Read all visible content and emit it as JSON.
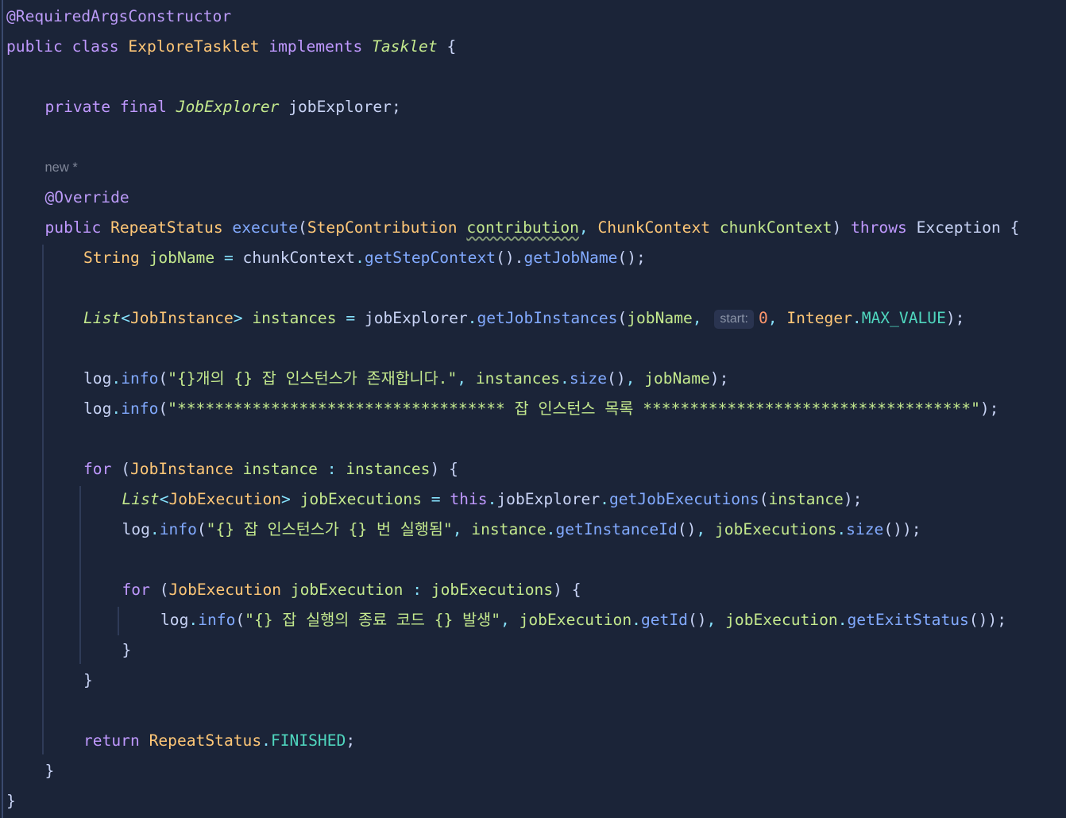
{
  "editor": {
    "lines": [
      {
        "indent": 0,
        "tokens": [
          {
            "t": "@RequiredArgsConstructor",
            "c": "#bb9af7"
          }
        ]
      },
      {
        "indent": 0,
        "tokens": [
          {
            "t": "public class ",
            "c": "#c099ff"
          },
          {
            "t": "ExploreTasklet",
            "c": "#ffc777"
          },
          {
            "t": " implements ",
            "c": "#c099ff"
          },
          {
            "t": "Tasklet",
            "c": "#c3e88d",
            "s": "italic"
          },
          {
            "t": " {",
            "c": "#c8d3f5"
          }
        ]
      },
      {
        "indent": 0,
        "tokens": []
      },
      {
        "indent": 1,
        "tokens": [
          {
            "t": "private final ",
            "c": "#c099ff"
          },
          {
            "t": "JobExplorer",
            "c": "#c3e88d",
            "s": "italic"
          },
          {
            "t": " jobExplorer;",
            "c": "#c8d3f5"
          }
        ]
      },
      {
        "indent": 0,
        "tokens": []
      },
      {
        "indent": 1,
        "meta": true,
        "tokens": [
          {
            "t": "new *",
            "c": "#7f8698"
          }
        ]
      },
      {
        "indent": 1,
        "tokens": [
          {
            "t": "@Override",
            "c": "#bb9af7"
          }
        ]
      },
      {
        "indent": 1,
        "tokens": [
          {
            "t": "public ",
            "c": "#c099ff"
          },
          {
            "t": "RepeatStatus",
            "c": "#ffc777"
          },
          {
            "t": " execute",
            "c": "#82aaff"
          },
          {
            "t": "(",
            "c": "#c8d3f5"
          },
          {
            "t": "StepContribution",
            "c": "#ffc777"
          },
          {
            "t": " ",
            "c": "#c8d3f5"
          },
          {
            "t": "contribution",
            "c": "#c3e88d",
            "u": true
          },
          {
            "t": ", ",
            "c": "#86e1fc"
          },
          {
            "t": "ChunkContext",
            "c": "#ffc777"
          },
          {
            "t": " chunkContext",
            "c": "#c3e88d"
          },
          {
            "t": ") ",
            "c": "#c8d3f5"
          },
          {
            "t": "throws ",
            "c": "#c099ff"
          },
          {
            "t": "Exception",
            "c": "#c8d3f5"
          },
          {
            "t": " {",
            "c": "#c8d3f5"
          }
        ]
      },
      {
        "indent": 2,
        "tokens": [
          {
            "t": "String",
            "c": "#ffc777"
          },
          {
            "t": " jobName ",
            "c": "#c3e88d"
          },
          {
            "t": "= ",
            "c": "#86e1fc"
          },
          {
            "t": "chunkContext",
            "c": "#c8d3f5"
          },
          {
            "t": ".",
            "c": "#86e1fc"
          },
          {
            "t": "getStepContext",
            "c": "#82aaff"
          },
          {
            "t": "().",
            "c": "#c8d3f5"
          },
          {
            "t": "getJobName",
            "c": "#82aaff"
          },
          {
            "t": "();",
            "c": "#c8d3f5"
          }
        ]
      },
      {
        "indent": 0,
        "tokens": []
      },
      {
        "indent": 2,
        "tokens": [
          {
            "t": "List",
            "c": "#c3e88d",
            "s": "italic"
          },
          {
            "t": "<",
            "c": "#86e1fc"
          },
          {
            "t": "JobInstance",
            "c": "#ffc777"
          },
          {
            "t": "> ",
            "c": "#86e1fc"
          },
          {
            "t": "instances ",
            "c": "#c3e88d"
          },
          {
            "t": "= ",
            "c": "#86e1fc"
          },
          {
            "t": "jobExplorer",
            "c": "#c8d3f5"
          },
          {
            "t": ".",
            "c": "#86e1fc"
          },
          {
            "t": "getJobInstances",
            "c": "#82aaff"
          },
          {
            "t": "(",
            "c": "#c8d3f5"
          },
          {
            "t": "jobName",
            "c": "#c3e88d"
          },
          {
            "t": ", ",
            "c": "#86e1fc"
          },
          {
            "hint": "start:"
          },
          {
            "t": "0",
            "c": "#ff966c"
          },
          {
            "t": ", ",
            "c": "#86e1fc"
          },
          {
            "t": "Integer",
            "c": "#ffc777"
          },
          {
            "t": ".",
            "c": "#86e1fc"
          },
          {
            "t": "MAX_VALUE",
            "c": "#4fd6be"
          },
          {
            "t": ");",
            "c": "#c8d3f5"
          }
        ]
      },
      {
        "indent": 0,
        "tokens": []
      },
      {
        "indent": 2,
        "tokens": [
          {
            "t": "log",
            "c": "#c8d3f5"
          },
          {
            "t": ".",
            "c": "#86e1fc"
          },
          {
            "t": "info",
            "c": "#82aaff"
          },
          {
            "t": "(",
            "c": "#c8d3f5"
          },
          {
            "t": "\"{}개의 {} 잡 인스턴스가 존재합니다.\"",
            "c": "#c3e88d"
          },
          {
            "t": ", ",
            "c": "#86e1fc"
          },
          {
            "t": "instances",
            "c": "#c3e88d"
          },
          {
            "t": ".",
            "c": "#86e1fc"
          },
          {
            "t": "size",
            "c": "#82aaff"
          },
          {
            "t": "()",
            "c": "#c8d3f5"
          },
          {
            "t": ", ",
            "c": "#86e1fc"
          },
          {
            "t": "jobName",
            "c": "#c3e88d"
          },
          {
            "t": ");",
            "c": "#c8d3f5"
          }
        ]
      },
      {
        "indent": 2,
        "tokens": [
          {
            "t": "log",
            "c": "#c8d3f5"
          },
          {
            "t": ".",
            "c": "#86e1fc"
          },
          {
            "t": "info",
            "c": "#82aaff"
          },
          {
            "t": "(",
            "c": "#c8d3f5"
          },
          {
            "t": "\"*********************************** 잡 인스턴스 목록 ***********************************\"",
            "c": "#c3e88d"
          },
          {
            "t": ");",
            "c": "#c8d3f5"
          }
        ]
      },
      {
        "indent": 0,
        "tokens": []
      },
      {
        "indent": 2,
        "tokens": [
          {
            "t": "for ",
            "c": "#c099ff"
          },
          {
            "t": "(",
            "c": "#c8d3f5"
          },
          {
            "t": "JobInstance",
            "c": "#ffc777"
          },
          {
            "t": " instance ",
            "c": "#c3e88d"
          },
          {
            "t": ": ",
            "c": "#86e1fc"
          },
          {
            "t": "instances",
            "c": "#c3e88d"
          },
          {
            "t": ") {",
            "c": "#c8d3f5"
          }
        ]
      },
      {
        "indent": 3,
        "tokens": [
          {
            "t": "List",
            "c": "#c3e88d",
            "s": "italic"
          },
          {
            "t": "<",
            "c": "#86e1fc"
          },
          {
            "t": "JobExecution",
            "c": "#ffc777"
          },
          {
            "t": "> ",
            "c": "#86e1fc"
          },
          {
            "t": "jobExecutions ",
            "c": "#c3e88d"
          },
          {
            "t": "= ",
            "c": "#86e1fc"
          },
          {
            "t": "this",
            "c": "#c099ff"
          },
          {
            "t": ".",
            "c": "#86e1fc"
          },
          {
            "t": "jobExplorer",
            "c": "#c8d3f5"
          },
          {
            "t": ".",
            "c": "#86e1fc"
          },
          {
            "t": "getJobExecutions",
            "c": "#82aaff"
          },
          {
            "t": "(",
            "c": "#c8d3f5"
          },
          {
            "t": "instance",
            "c": "#c3e88d"
          },
          {
            "t": ");",
            "c": "#c8d3f5"
          }
        ]
      },
      {
        "indent": 3,
        "tokens": [
          {
            "t": "log",
            "c": "#c8d3f5"
          },
          {
            "t": ".",
            "c": "#86e1fc"
          },
          {
            "t": "info",
            "c": "#82aaff"
          },
          {
            "t": "(",
            "c": "#c8d3f5"
          },
          {
            "t": "\"{} 잡 인스턴스가 {} 번 실행됨\"",
            "c": "#c3e88d"
          },
          {
            "t": ", ",
            "c": "#86e1fc"
          },
          {
            "t": "instance",
            "c": "#c3e88d"
          },
          {
            "t": ".",
            "c": "#86e1fc"
          },
          {
            "t": "getInstanceId",
            "c": "#82aaff"
          },
          {
            "t": "()",
            "c": "#c8d3f5"
          },
          {
            "t": ", ",
            "c": "#86e1fc"
          },
          {
            "t": "jobExecutions",
            "c": "#c3e88d"
          },
          {
            "t": ".",
            "c": "#86e1fc"
          },
          {
            "t": "size",
            "c": "#82aaff"
          },
          {
            "t": "());",
            "c": "#c8d3f5"
          }
        ]
      },
      {
        "indent": 0,
        "tokens": []
      },
      {
        "indent": 3,
        "tokens": [
          {
            "t": "for ",
            "c": "#c099ff"
          },
          {
            "t": "(",
            "c": "#c8d3f5"
          },
          {
            "t": "JobExecution",
            "c": "#ffc777"
          },
          {
            "t": " jobExecution ",
            "c": "#c3e88d"
          },
          {
            "t": ": ",
            "c": "#86e1fc"
          },
          {
            "t": "jobExecutions",
            "c": "#c3e88d"
          },
          {
            "t": ") {",
            "c": "#c8d3f5"
          }
        ]
      },
      {
        "indent": 4,
        "tokens": [
          {
            "t": "log",
            "c": "#c8d3f5"
          },
          {
            "t": ".",
            "c": "#86e1fc"
          },
          {
            "t": "info",
            "c": "#82aaff"
          },
          {
            "t": "(",
            "c": "#c8d3f5"
          },
          {
            "t": "\"{} 잡 실행의 종료 코드 {} 발생\"",
            "c": "#c3e88d"
          },
          {
            "t": ", ",
            "c": "#86e1fc"
          },
          {
            "t": "jobExecution",
            "c": "#c3e88d"
          },
          {
            "t": ".",
            "c": "#86e1fc"
          },
          {
            "t": "getId",
            "c": "#82aaff"
          },
          {
            "t": "()",
            "c": "#c8d3f5"
          },
          {
            "t": ", ",
            "c": "#86e1fc"
          },
          {
            "t": "jobExecution",
            "c": "#c3e88d"
          },
          {
            "t": ".",
            "c": "#86e1fc"
          },
          {
            "t": "getExitStatus",
            "c": "#82aaff"
          },
          {
            "t": "());",
            "c": "#c8d3f5"
          }
        ]
      },
      {
        "indent": 3,
        "tokens": [
          {
            "t": "}",
            "c": "#c8d3f5"
          }
        ]
      },
      {
        "indent": 2,
        "tokens": [
          {
            "t": "}",
            "c": "#c8d3f5"
          }
        ]
      },
      {
        "indent": 0,
        "tokens": []
      },
      {
        "indent": 2,
        "tokens": [
          {
            "t": "return ",
            "c": "#c099ff"
          },
          {
            "t": "RepeatStatus",
            "c": "#ffc777"
          },
          {
            "t": ".",
            "c": "#86e1fc"
          },
          {
            "t": "FINISHED",
            "c": "#4fd6be"
          },
          {
            "t": ";",
            "c": "#c8d3f5"
          }
        ]
      },
      {
        "indent": 1,
        "tokens": [
          {
            "t": "}",
            "c": "#c8d3f5"
          }
        ]
      },
      {
        "indent": 0,
        "tokens": [
          {
            "t": "}",
            "c": "#c8d3f5"
          }
        ]
      }
    ]
  }
}
